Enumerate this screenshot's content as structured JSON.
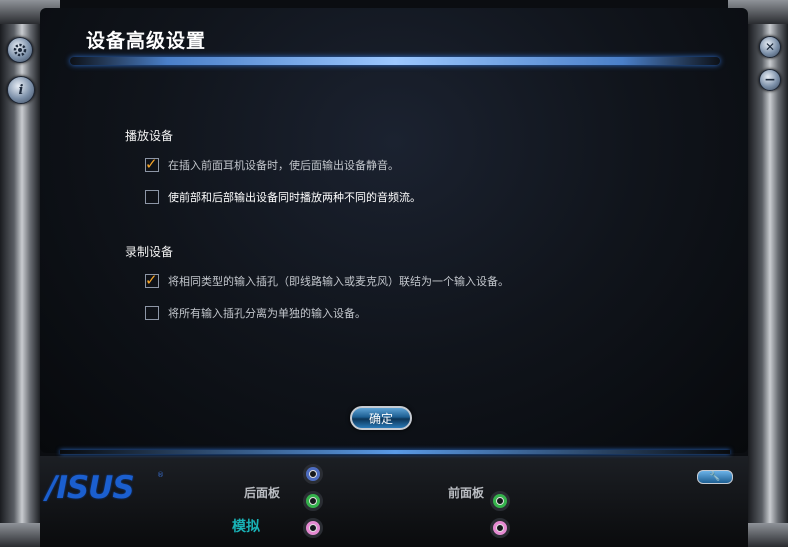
{
  "window": {
    "title": "设备高级设置"
  },
  "sidebar": {
    "gear_icon": "gear-icon",
    "info_icon": "info-icon",
    "info_glyph": "i",
    "close_glyph": "✕",
    "minimize_glyph": "−"
  },
  "playback": {
    "label": "播放设备",
    "options": [
      {
        "text": "在插入前面耳机设备时，使后面输出设备静音。",
        "checked": true
      },
      {
        "text": "使前部和后部输出设备同时播放两种不同的音频流。",
        "checked": false
      }
    ]
  },
  "recording": {
    "label": "录制设备",
    "options": [
      {
        "text": "将相同类型的输入插孔（即线路输入或麦克风）联结为一个输入设备。",
        "checked": true
      },
      {
        "text": "将所有输入插孔分离为单独的输入设备。",
        "checked": false
      }
    ]
  },
  "ok_button": "确定",
  "footer": {
    "logo": "/ISUS",
    "logo_mark": "®",
    "rear_panel": "后面板",
    "front_panel": "前面板",
    "analog": "模拟",
    "check_glyph": "✓",
    "wrench_glyph": "🔧",
    "jack_colors": {
      "blue": "#4d6cc0",
      "green": "#35b24c",
      "pink": "#e58ad2"
    },
    "accent_orange": "#f5a52a"
  }
}
